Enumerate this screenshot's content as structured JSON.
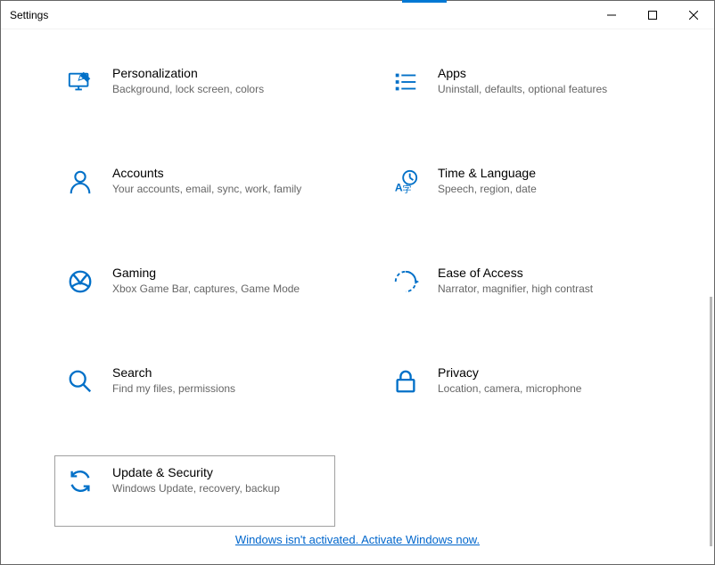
{
  "window": {
    "title": "Settings"
  },
  "categories": [
    {
      "title": "Personalization",
      "desc": "Background, lock screen, colors"
    },
    {
      "title": "Apps",
      "desc": "Uninstall, defaults, optional features"
    },
    {
      "title": "Accounts",
      "desc": "Your accounts, email, sync, work, family"
    },
    {
      "title": "Time & Language",
      "desc": "Speech, region, date"
    },
    {
      "title": "Gaming",
      "desc": "Xbox Game Bar, captures, Game Mode"
    },
    {
      "title": "Ease of Access",
      "desc": "Narrator, magnifier, high contrast"
    },
    {
      "title": "Search",
      "desc": "Find my files, permissions"
    },
    {
      "title": "Privacy",
      "desc": "Location, camera, microphone"
    },
    {
      "title": "Update & Security",
      "desc": "Windows Update, recovery, backup"
    }
  ],
  "activation": {
    "text": "Windows isn't activated. Activate Windows now."
  }
}
